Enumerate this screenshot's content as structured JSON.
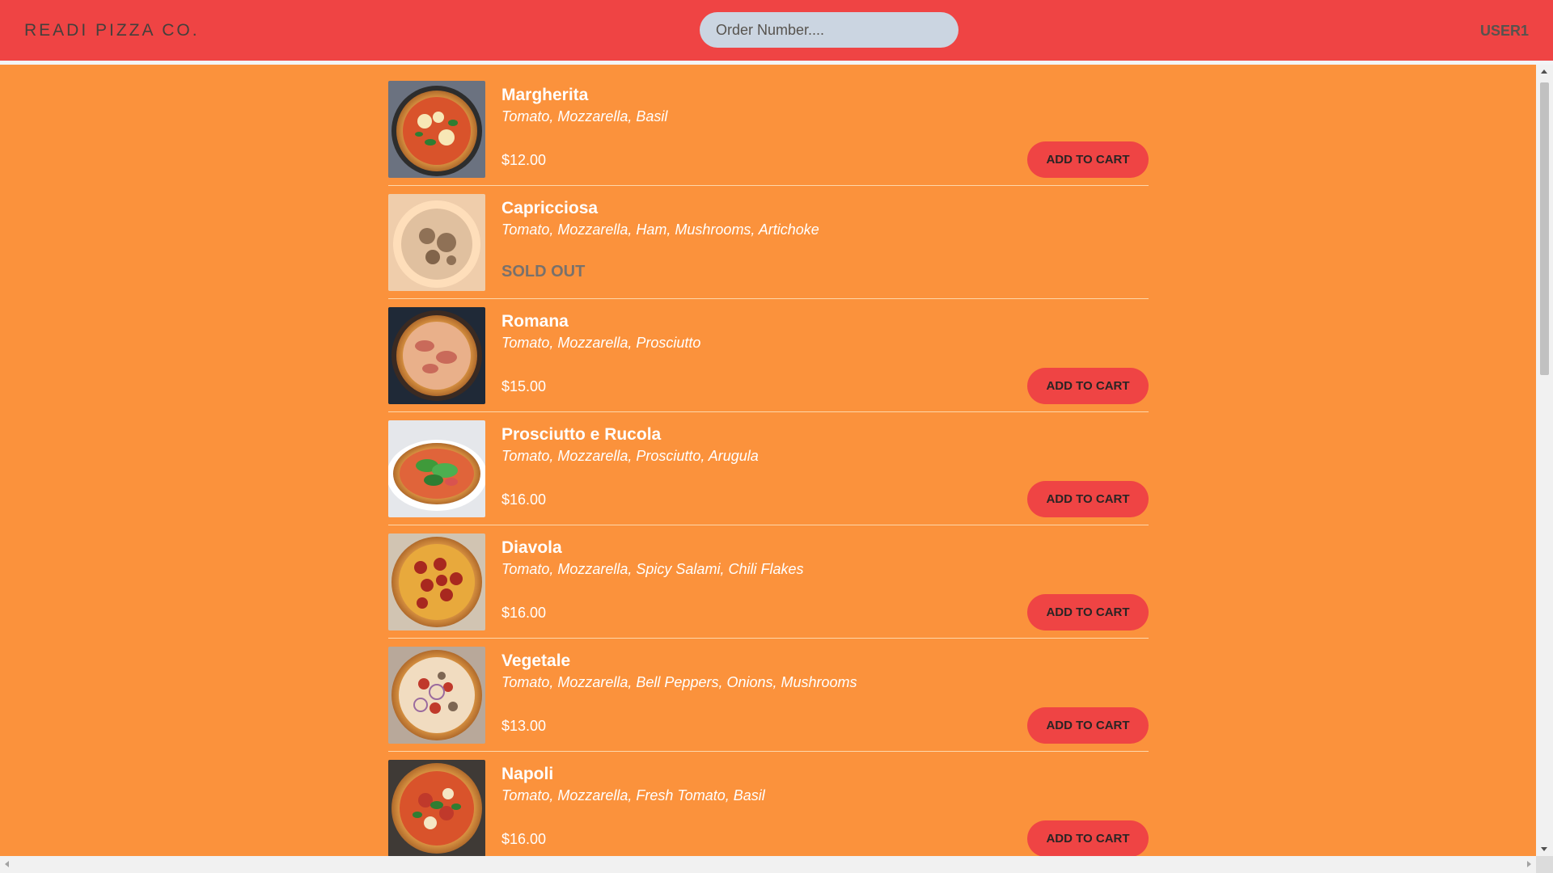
{
  "header": {
    "brand": "READI PIZZA CO.",
    "search_placeholder": "Order Number....",
    "user": "USER1"
  },
  "colors": {
    "header_bg": "#ef4444",
    "page_bg": "#fb923c",
    "button_bg": "#ef4444",
    "sold_out_text": "#78716c"
  },
  "menu": {
    "items": [
      {
        "name": "Margherita",
        "ingredients": "Tomato, Mozzarella, Basil",
        "price": "$12.00",
        "sold_out": false,
        "button": "ADD TO CART"
      },
      {
        "name": "Capricciosa",
        "ingredients": "Tomato, Mozzarella, Ham, Mushrooms, Artichoke",
        "status": "SOLD OUT",
        "sold_out": true
      },
      {
        "name": "Romana",
        "ingredients": "Tomato, Mozzarella, Prosciutto",
        "price": "$15.00",
        "sold_out": false,
        "button": "ADD TO CART"
      },
      {
        "name": "Prosciutto e Rucola",
        "ingredients": "Tomato, Mozzarella, Prosciutto, Arugula",
        "price": "$16.00",
        "sold_out": false,
        "button": "ADD TO CART"
      },
      {
        "name": "Diavola",
        "ingredients": "Tomato, Mozzarella, Spicy Salami, Chili Flakes",
        "price": "$16.00",
        "sold_out": false,
        "button": "ADD TO CART"
      },
      {
        "name": "Vegetale",
        "ingredients": "Tomato, Mozzarella, Bell Peppers, Onions, Mushrooms",
        "price": "$13.00",
        "sold_out": false,
        "button": "ADD TO CART"
      },
      {
        "name": "Napoli",
        "ingredients": "Tomato, Mozzarella, Fresh Tomato, Basil",
        "price": "$16.00",
        "sold_out": false,
        "button": "ADD TO CART"
      }
    ]
  }
}
